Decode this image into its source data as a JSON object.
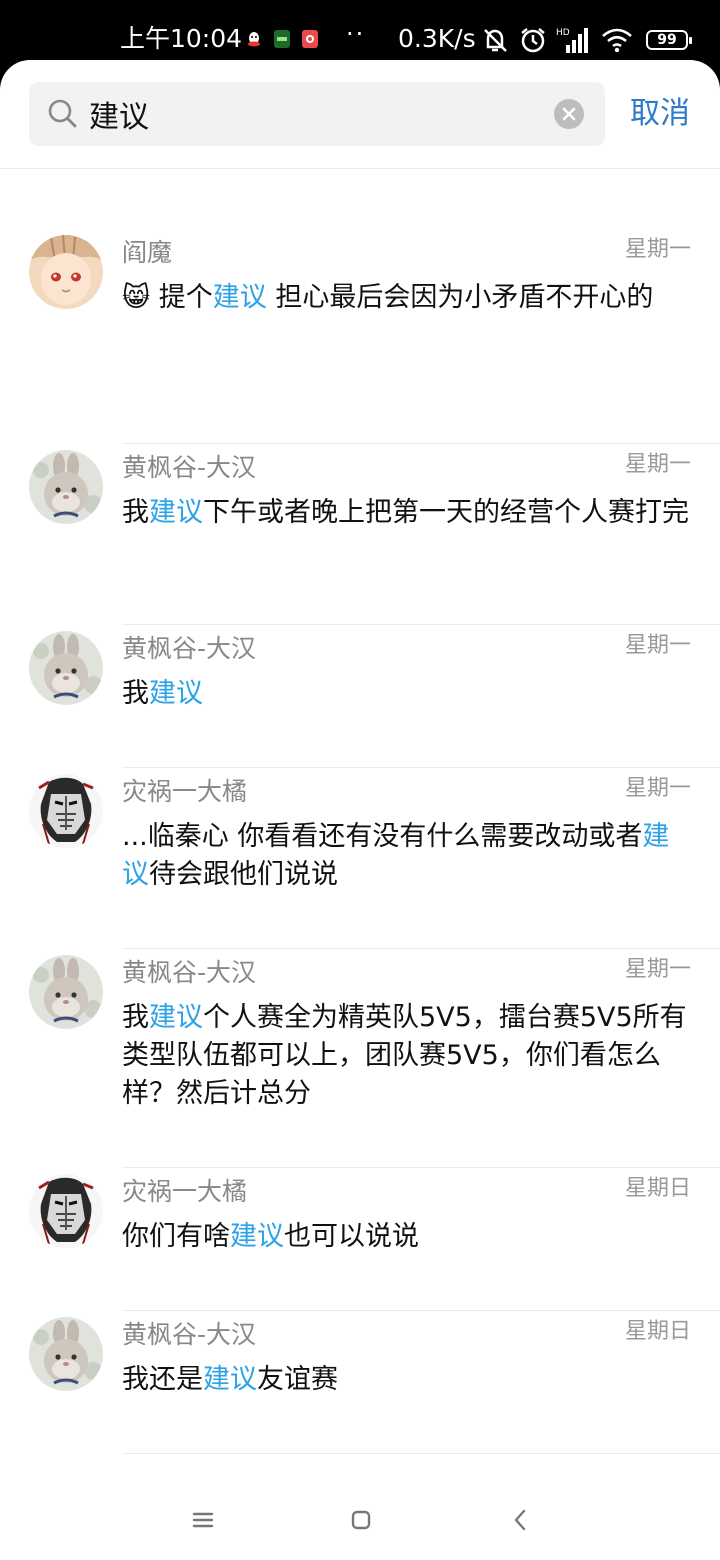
{
  "status_bar": {
    "time": "上午10:04",
    "dots": "··",
    "net_speed": "0.3K/s",
    "battery": "99",
    "signal_label": "HD"
  },
  "search": {
    "query": "建议",
    "cancel_label": "取消"
  },
  "results": [
    {
      "sender": "阎魔",
      "date": "星期一",
      "avatar": "anime-girl",
      "parts": [
        {
          "t": "😸 提个"
        },
        {
          "t": "建议",
          "hl": true
        },
        {
          "t": "  担心最后会因为小矛盾不开心的"
        }
      ]
    },
    {
      "sender": "黄枫谷-大汉",
      "date": "星期一",
      "avatar": "rabbit",
      "parts": [
        {
          "t": "我"
        },
        {
          "t": "建议",
          "hl": true
        },
        {
          "t": "下午或者晚上把第一天的经营个人赛打完"
        }
      ]
    },
    {
      "sender": "黄枫谷-大汉",
      "date": "星期一",
      "avatar": "rabbit",
      "parts": [
        {
          "t": "我"
        },
        {
          "t": "建议",
          "hl": true
        }
      ]
    },
    {
      "sender": "灾祸一大橘",
      "date": "星期一",
      "avatar": "goblin",
      "parts": [
        {
          "t": "...临秦心  你看看还有没有什么需要改动或者"
        },
        {
          "t": "建议",
          "hl": true
        },
        {
          "t": "待会跟他们说说"
        }
      ]
    },
    {
      "sender": "黄枫谷-大汉",
      "date": "星期一",
      "avatar": "rabbit",
      "parts": [
        {
          "t": "我"
        },
        {
          "t": "建议",
          "hl": true
        },
        {
          "t": "个人赛全为精英队5V5，擂台赛5V5所有类型队伍都可以上，团队赛5V5，你们看怎么样？然后计总分"
        }
      ]
    },
    {
      "sender": "灾祸一大橘",
      "date": "星期日",
      "avatar": "goblin",
      "parts": [
        {
          "t": "你们有啥"
        },
        {
          "t": "建议",
          "hl": true
        },
        {
          "t": "也可以说说"
        }
      ]
    },
    {
      "sender": "黄枫谷-大汉",
      "date": "星期日",
      "avatar": "rabbit",
      "parts": [
        {
          "t": "我还是"
        },
        {
          "t": "建议",
          "hl": true
        },
        {
          "t": "友谊赛"
        }
      ]
    }
  ],
  "nav": {
    "items": [
      "menu-icon",
      "home-icon",
      "back-icon"
    ]
  },
  "colors": {
    "highlight": "#2ba3e6",
    "cancel": "#2f7bcb"
  }
}
